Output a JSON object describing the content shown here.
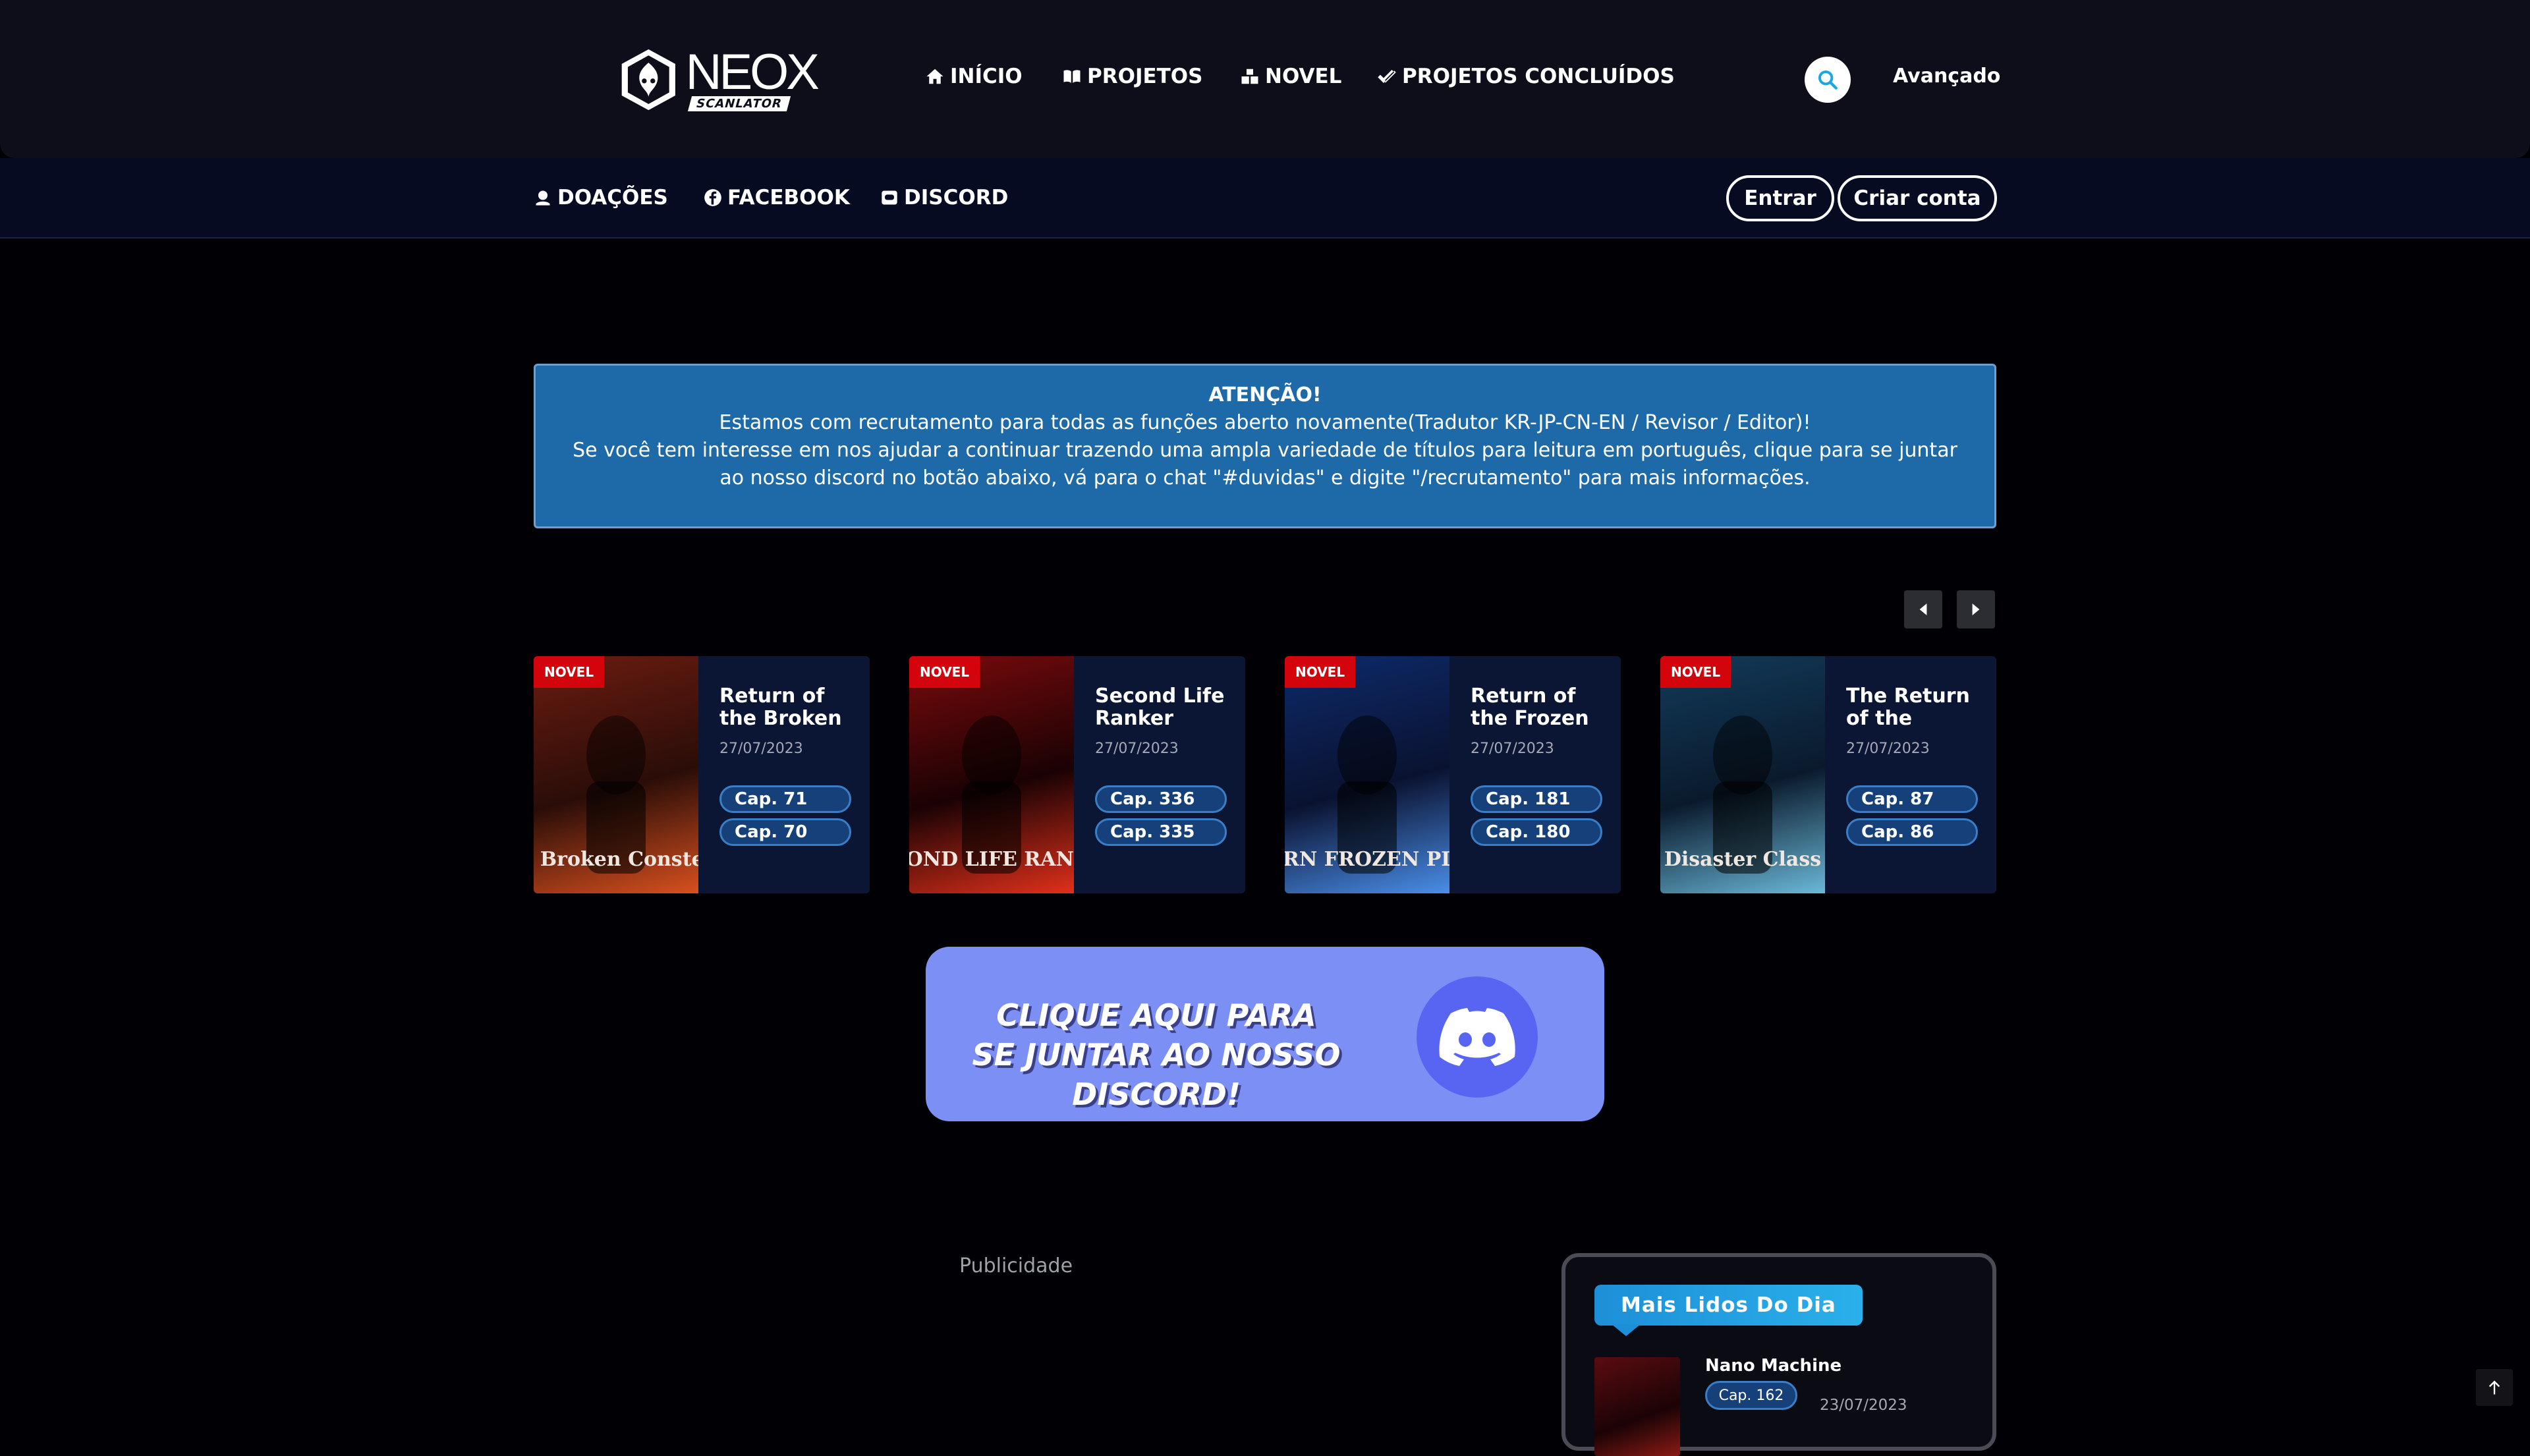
{
  "header": {
    "logo_title": "NEOX",
    "logo_subtitle": "SCANLATOR",
    "nav": [
      {
        "label": "INÍCIO",
        "icon": "home-icon"
      },
      {
        "label": "PROJETOS",
        "icon": "book-open-icon"
      },
      {
        "label": "NOVEL",
        "icon": "boxes-icon"
      },
      {
        "label": "PROJETOS CONCLUÍDOS",
        "icon": "check-double-icon"
      }
    ],
    "search_icon": "search-icon",
    "advanced_label": "Avançado"
  },
  "subnav": {
    "items": [
      {
        "label": "DOAÇÕES",
        "icon": "donate-icon"
      },
      {
        "label": "FACEBOOK",
        "icon": "facebook-icon"
      },
      {
        "label": "DISCORD",
        "icon": "discord-icon"
      }
    ],
    "login_label": "Entrar",
    "register_label": "Criar conta"
  },
  "notice": {
    "title": "ATENÇÃO!",
    "line1": "Estamos com recrutamento para todas as funções aberto novamente(Tradutor KR-JP-CN-EN / Revisor / Editor)!",
    "line2": "Se você tem interesse em nos ajudar a continuar trazendo uma ampla variedade de títulos para leitura em português, clique para se juntar ao nosso discord no botão abaixo, vá para o chat \"#duvidas\" e digite \"/recrutamento\" para mais informações."
  },
  "slider": {
    "cards": [
      {
        "badge": "NOVEL",
        "title": "Return of the Broken Constellation",
        "date": "27/07/2023",
        "chapters": [
          "Cap. 71",
          "Cap. 70"
        ],
        "cover_text": "Return Broken Constellation",
        "cover_colors": [
          "#6b1c10",
          "#2a0d08",
          "#d8501e"
        ]
      },
      {
        "badge": "NOVEL",
        "title": "Second Life Ranker",
        "date": "27/07/2023",
        "chapters": [
          "Cap. 336",
          "Cap. 335"
        ],
        "cover_text": "SECOND LIFE RANKER",
        "cover_colors": [
          "#7a0a0c",
          "#1a0204",
          "#e0301a"
        ]
      },
      {
        "badge": "NOVEL",
        "title": "Return of the Frozen Player",
        "date": "27/07/2023",
        "chapters": [
          "Cap. 181",
          "Cap. 180"
        ],
        "cover_text": "RETURN FROZEN PLAYER",
        "cover_colors": [
          "#0d2a6a",
          "#0a1230",
          "#4a8ee8"
        ]
      },
      {
        "badge": "NOVEL",
        "title": "The Return of the Disaster-Class Hero",
        "date": "27/07/2023",
        "chapters": [
          "Cap. 87",
          "Cap. 86"
        ],
        "cover_text": "Disaster Class",
        "cover_colors": [
          "#123a5a",
          "#0a1a2c",
          "#6ab8d8"
        ]
      }
    ]
  },
  "discord_banner": {
    "text": "CLIQUE AQUI PARA SE JUNTAR AO NOSSO DISCORD!"
  },
  "ad": {
    "label": "Publicidade"
  },
  "top_list": {
    "title": "Mais Lidos Do Dia",
    "items": [
      {
        "name": "Nano Machine",
        "chapter": "Cap. 162",
        "date": "23/07/2023"
      }
    ]
  }
}
